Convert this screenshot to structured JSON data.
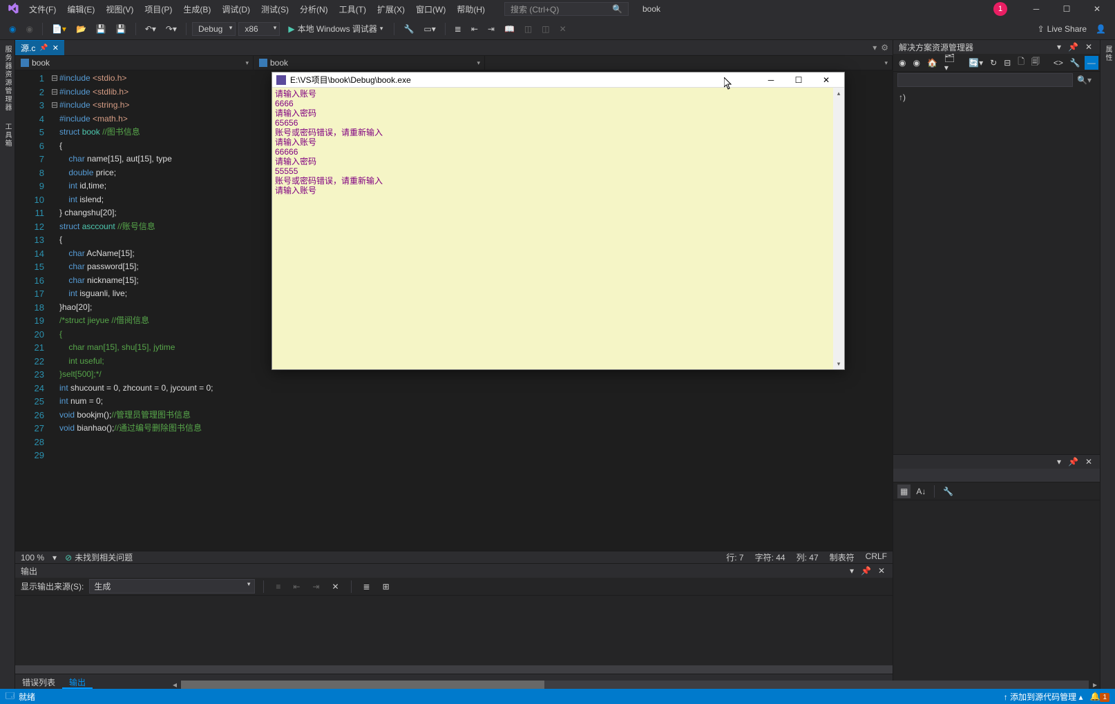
{
  "menu": [
    "文件(F)",
    "编辑(E)",
    "视图(V)",
    "项目(P)",
    "生成(B)",
    "调试(D)",
    "测试(S)",
    "分析(N)",
    "工具(T)",
    "扩展(X)",
    "窗口(W)",
    "帮助(H)"
  ],
  "search": {
    "placeholder": "搜索 (Ctrl+Q)"
  },
  "title_project": "book",
  "user_badge": "1",
  "toolbar": {
    "config": "Debug",
    "platform": "x86",
    "run_label": "本地 Windows 调试器",
    "live_share": "Live Share"
  },
  "left_tabs": [
    "服务器资源管理器",
    "工具箱"
  ],
  "right_tabs": [
    "属性"
  ],
  "doc_tab": {
    "name": "源.c"
  },
  "nav": {
    "left": "book",
    "mid": "book",
    "right": ""
  },
  "code": {
    "lines": [
      {
        "n": 1,
        "fold": "",
        "t": "#include <stdio.h>",
        "cls": [
          "inc"
        ]
      },
      {
        "n": 2,
        "fold": "",
        "t": "#include <stdlib.h>",
        "cls": [
          "inc"
        ]
      },
      {
        "n": 3,
        "fold": "",
        "t": "#include <string.h>",
        "cls": [
          "inc"
        ]
      },
      {
        "n": 4,
        "fold": "",
        "t": "#include <math.h>",
        "cls": [
          "inc"
        ]
      },
      {
        "n": 5,
        "fold": "⊟",
        "t": "struct book //图书信息",
        "cls": [
          "struct"
        ]
      },
      {
        "n": 6,
        "fold": "",
        "t": "{",
        "cls": []
      },
      {
        "n": 7,
        "fold": "",
        "t": "    char name[15], aut[15], type",
        "cls": [
          "decl"
        ]
      },
      {
        "n": 8,
        "fold": "",
        "t": "    double price;",
        "cls": [
          "decl"
        ]
      },
      {
        "n": 9,
        "fold": "",
        "t": "    int id,time;",
        "cls": [
          "decl"
        ]
      },
      {
        "n": 10,
        "fold": "",
        "t": "    int islend;",
        "cls": [
          "decl"
        ]
      },
      {
        "n": 11,
        "fold": "",
        "t": "} changshu[20];",
        "cls": []
      },
      {
        "n": 12,
        "fold": "⊟",
        "t": "struct asccount //账号信息",
        "cls": [
          "struct"
        ]
      },
      {
        "n": 13,
        "fold": "",
        "t": "{",
        "cls": []
      },
      {
        "n": 14,
        "fold": "",
        "t": "    char AcName[15];",
        "cls": [
          "decl"
        ]
      },
      {
        "n": 15,
        "fold": "",
        "t": "    char password[15];",
        "cls": [
          "decl"
        ]
      },
      {
        "n": 16,
        "fold": "",
        "t": "    char nickname[15];",
        "cls": [
          "decl"
        ]
      },
      {
        "n": 17,
        "fold": "",
        "t": "    int isguanli, live;",
        "cls": [
          "decl"
        ]
      },
      {
        "n": 18,
        "fold": "",
        "t": "",
        "cls": []
      },
      {
        "n": 19,
        "fold": "",
        "t": "}hao[20];",
        "cls": []
      },
      {
        "n": 20,
        "fold": "⊟",
        "t": "/*struct jieyue //借阅信息",
        "cls": [
          "com"
        ]
      },
      {
        "n": 21,
        "fold": "",
        "t": "{",
        "cls": [
          "com"
        ]
      },
      {
        "n": 22,
        "fold": "",
        "t": "    char man[15], shu[15], jytime",
        "cls": [
          "com"
        ]
      },
      {
        "n": 23,
        "fold": "",
        "t": "    int useful;",
        "cls": [
          "com"
        ]
      },
      {
        "n": 24,
        "fold": "",
        "t": "}selt[500];*/",
        "cls": [
          "com"
        ]
      },
      {
        "n": 25,
        "fold": "",
        "t": "int shucount = 0, zhcount = 0, jycount = 0;",
        "cls": [
          "decl"
        ]
      },
      {
        "n": 26,
        "fold": "",
        "t": "int num = 0;",
        "cls": [
          "decl"
        ]
      },
      {
        "n": 27,
        "fold": "",
        "t": "",
        "cls": []
      },
      {
        "n": 28,
        "fold": "",
        "t": "void bookjm();//管理员管理图书信息",
        "cls": [
          "func"
        ]
      },
      {
        "n": 29,
        "fold": "",
        "t": "void bianhao();//通过编号删除图书信息",
        "cls": [
          "func"
        ]
      }
    ]
  },
  "editor_status": {
    "zoom": "100 %",
    "issues": "未找到相关问题",
    "line": "行: 7",
    "char": "字符: 44",
    "col": "列: 47",
    "tabs": "制表符",
    "eol": "CRLF"
  },
  "output": {
    "title": "输出",
    "source_label": "显示输出来源(S):",
    "source_value": "生成"
  },
  "bottom_tabs": {
    "errors": "错误列表",
    "output": "输出"
  },
  "solution": {
    "title": "解决方案资源管理器",
    "search_placeholder": "",
    "up_arrow": "↑)"
  },
  "props": {
    "title": ""
  },
  "statusbar": {
    "ready": "就绪",
    "add_source": "添加到源代码管理",
    "notif": "1"
  },
  "console": {
    "title": "E:\\VS项目\\book\\Debug\\book.exe",
    "lines": [
      "请输入账号",
      "6666",
      "请输入密码",
      "65656",
      "账号或密码错误，请重新输入",
      "请输入账号",
      "66666",
      "请输入密码",
      "55555",
      "账号或密码错误，请重新输入",
      "请输入账号"
    ]
  }
}
